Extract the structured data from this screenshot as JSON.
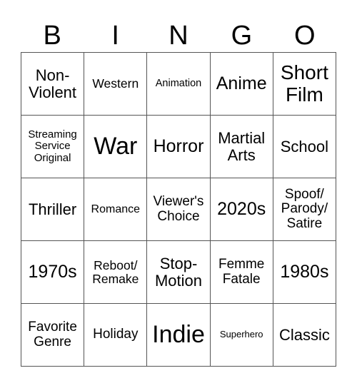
{
  "header": {
    "letters": [
      "B",
      "I",
      "N",
      "G",
      "O"
    ]
  },
  "cells": [
    "Non-\nViolent",
    "Western",
    "Animation",
    "Anime",
    "Short\nFilm",
    "Streaming\nService\nOriginal",
    "War",
    "Horror",
    "Martial\nArts",
    "School",
    "Thriller",
    "Romance",
    "Viewer's\nChoice",
    "2020s",
    "Spoof/\nParody/\nSatire",
    "1970s",
    "Reboot/\nRemake",
    "Stop-\nMotion",
    "Femme\nFatale",
    "1980s",
    "Favorite\nGenre",
    "Holiday",
    "Indie",
    "Superhero",
    "Classic"
  ]
}
